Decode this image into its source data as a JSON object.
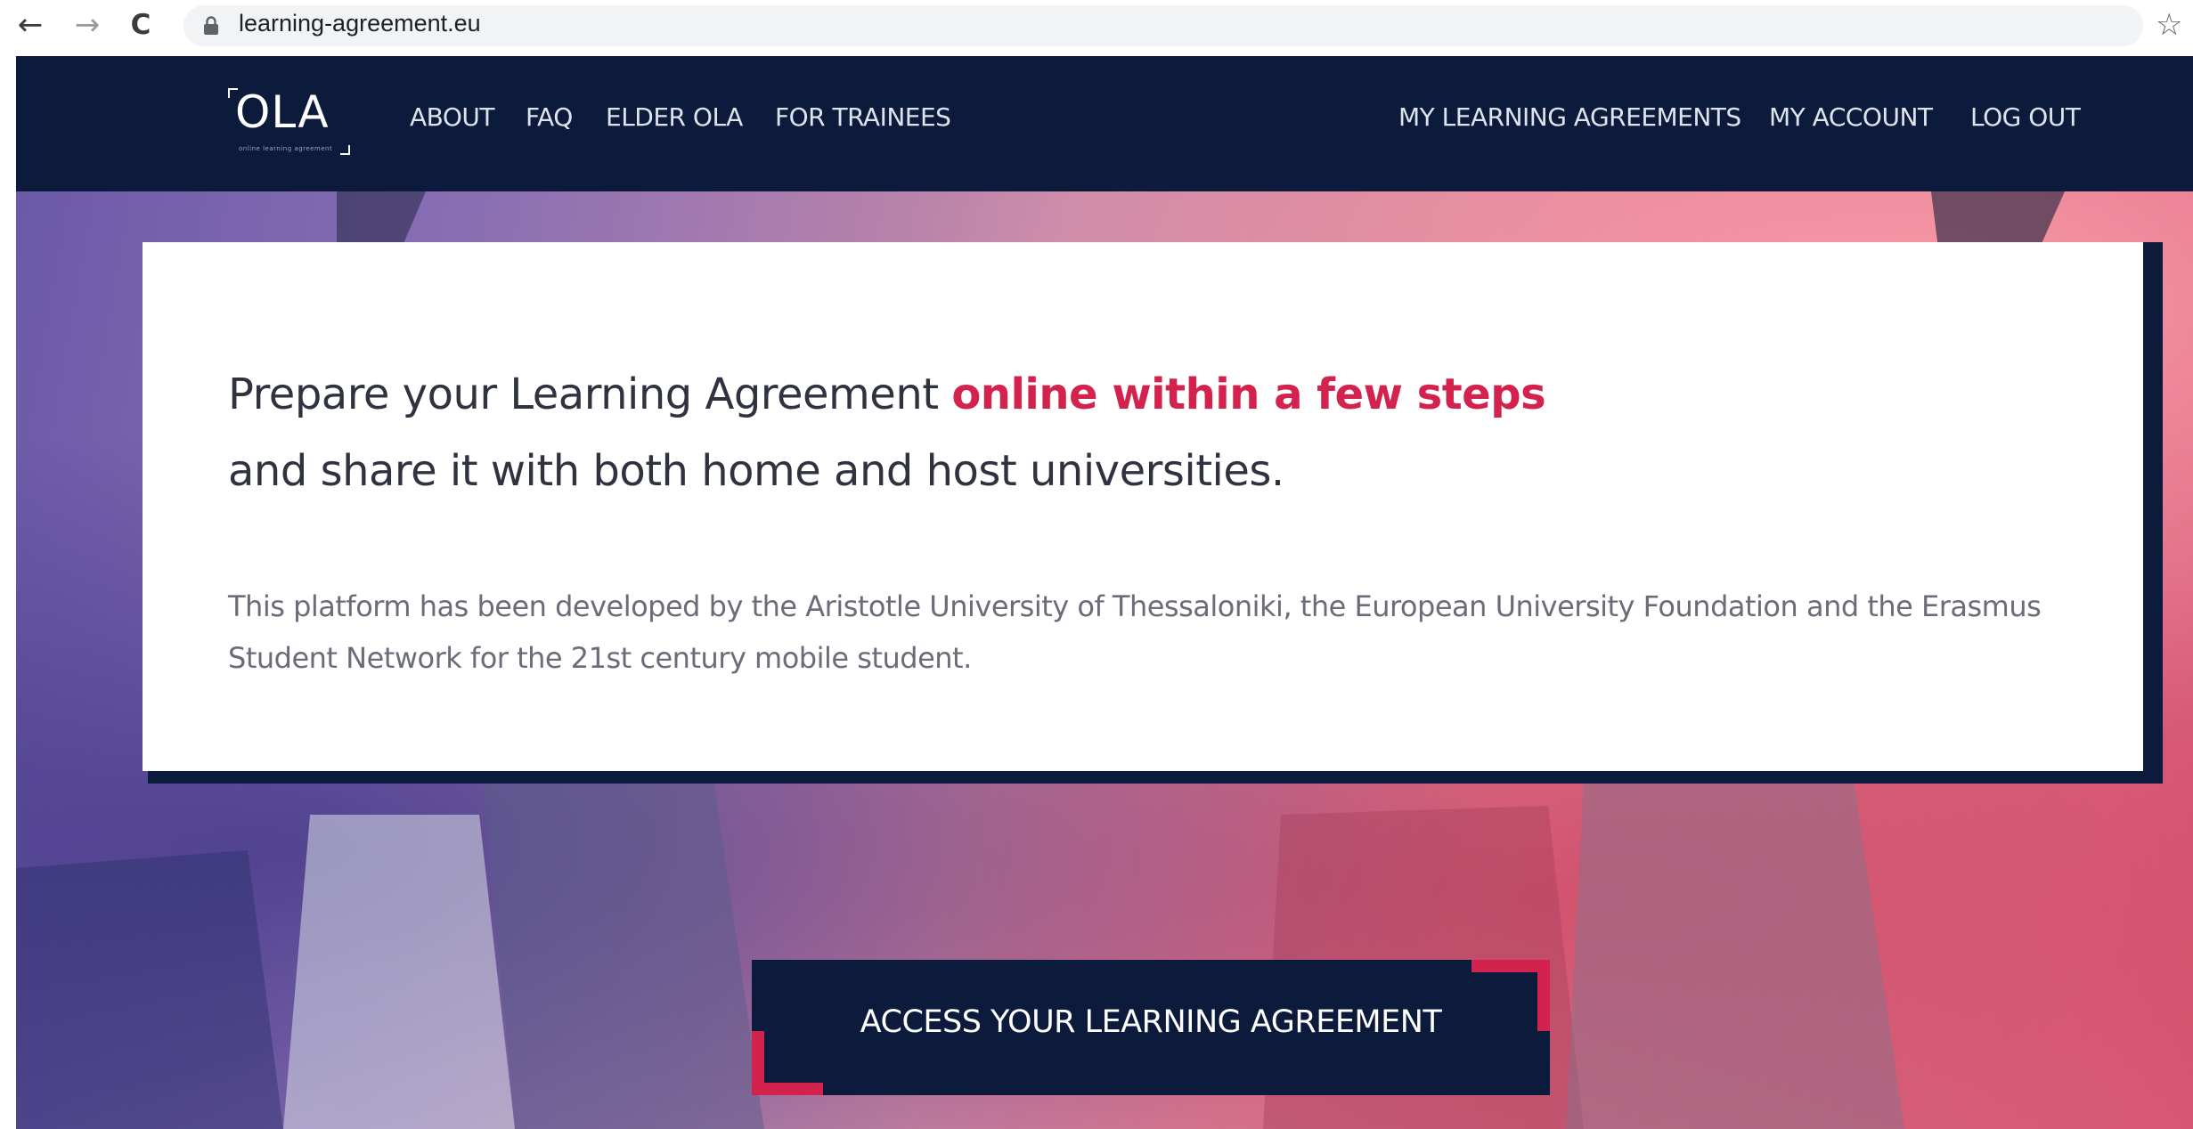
{
  "browser": {
    "url": "learning-agreement.eu",
    "back_glyph": "←",
    "forward_glyph": "→",
    "reload_glyph": "C",
    "star_glyph": "☆"
  },
  "header": {
    "logo_text": "OLA",
    "logo_subtext": "online learning agreement",
    "nav_left": [
      "ABOUT",
      "FAQ",
      "ELDER OLA",
      "FOR TRAINEES"
    ],
    "nav_right": [
      "MY LEARNING AGREEMENTS",
      "MY ACCOUNT",
      "LOG OUT"
    ]
  },
  "hero": {
    "headline_start": "Prepare your Learning Agreement ",
    "headline_highlight": "online within a few steps",
    "headline_line2": "and share it with both home and host universities.",
    "description": "This platform has been developed by the Aristotle University of Thessaloniki, the European University Foundation and the Erasmus Student Network for the 21st century mobile student.",
    "cta_label": "ACCESS YOUR LEARNING AGREEMENT"
  },
  "colors": {
    "navy": "#0c1b3c",
    "accent": "#d3224d"
  },
  "icons": {
    "back": "arrow-left-icon",
    "forward": "arrow-right-icon",
    "reload": "reload-icon",
    "lock": "lock-icon",
    "bookmark": "star-icon"
  }
}
